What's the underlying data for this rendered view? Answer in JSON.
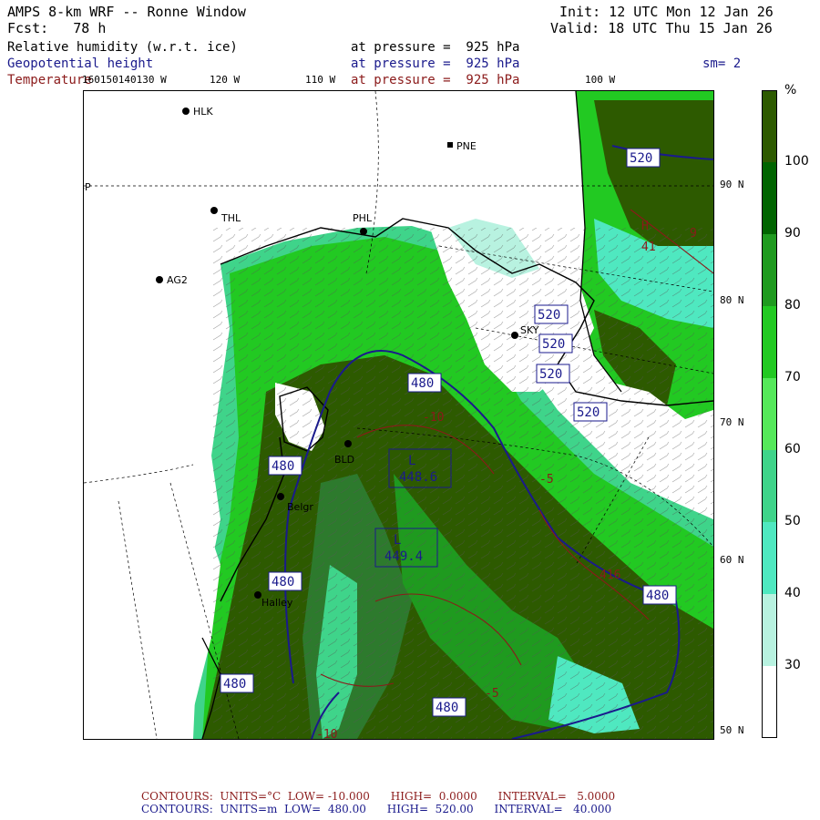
{
  "header": {
    "title": "AMPS 8-km WRF -- Ronne Window",
    "fcst": "Fcst:   78 h",
    "init": "Init: 12 UTC Mon 12 Jan 26",
    "valid": "Valid: 18 UTC Thu 15 Jan 26",
    "field1": "Relative humidity (w.r.t. ice)",
    "field2": "Geopotential height",
    "field3": "Temperature",
    "pressure1": "at pressure =  925 hPa",
    "pressure2": "at pressure =  925 hPa",
    "pressure3": "at pressure =  925 hPa",
    "smoothing": "sm= 2"
  },
  "lon_labels": [
    {
      "text": "160150140130 W"
    },
    {
      "text": "120 W"
    },
    {
      "text": "110 W"
    },
    {
      "text": "100 W"
    }
  ],
  "lat_labels": [
    "90 N",
    "80 N",
    "70 N",
    "60 N",
    "50 N"
  ],
  "stations": [
    {
      "name": "HLK"
    },
    {
      "name": "THL"
    },
    {
      "name": "PHL"
    },
    {
      "name": "PNE"
    },
    {
      "name": "AG2"
    },
    {
      "name": "SKY"
    },
    {
      "name": "BLD"
    },
    {
      "name": "Belgr"
    },
    {
      "name": "Halley"
    },
    {
      "name": "SP"
    }
  ],
  "height_labels": [
    "520",
    "520",
    "520",
    "520",
    "520",
    "480",
    "480",
    "480",
    "480",
    "480",
    "480"
  ],
  "lows": [
    {
      "mark": "L",
      "value": "448.6"
    },
    {
      "mark": "L",
      "value": "449.4"
    }
  ],
  "temp_labels": [
    "-10",
    "-5",
    "-5",
    "-10"
  ],
  "other_marks": {
    "high": "H",
    "value41": "41",
    "value416": "416",
    "value9": "9"
  },
  "colorbar": {
    "unit": "%",
    "ticks": [
      "100",
      "90",
      "80",
      "70",
      "60",
      "50",
      "40",
      "30"
    ],
    "colors": [
      "#2d5a00",
      "#006400",
      "#1f9a1f",
      "#22c922",
      "#55e85a",
      "#3fd48a",
      "#4fe8c0",
      "#b8f2e0",
      "#ffffff"
    ]
  },
  "footer": {
    "line1": "CONTOURS:  UNITS=°C  LOW= -10.000      HIGH=  0.0000      INTERVAL=   5.0000",
    "line2": "CONTOURS:  UNITS=m  LOW=  480.00      HIGH=  520.00      INTERVAL=   40.000"
  }
}
